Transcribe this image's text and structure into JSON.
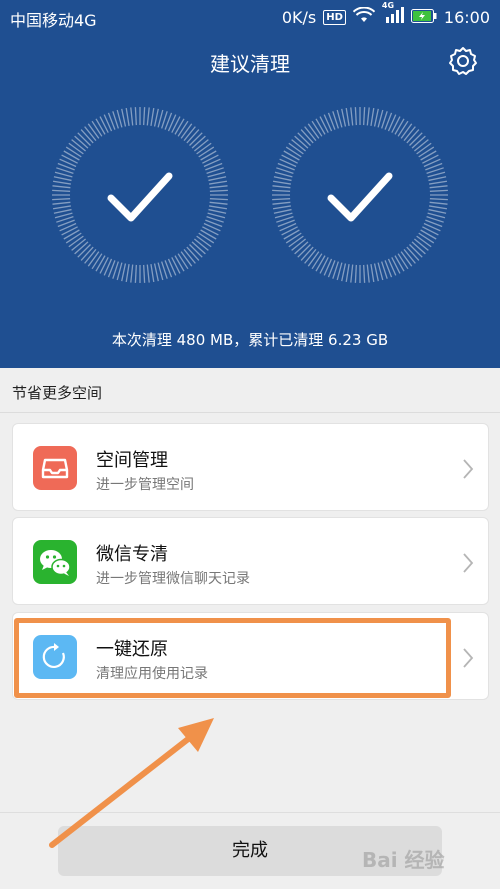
{
  "status_bar": {
    "carrier": "中国移动4G",
    "speed": "0K/s",
    "hd_badge": "HD",
    "network_badge": "4G",
    "time": "16:00"
  },
  "header": {
    "title": "建议清理",
    "summary": "本次清理 480 MB，累计已清理 6.23 GB"
  },
  "section": {
    "title": "节省更多空间"
  },
  "items": [
    {
      "title": "空间管理",
      "subtitle": "进一步管理空间",
      "icon": "storage-tray-icon",
      "color": "#ef6a57"
    },
    {
      "title": "微信专清",
      "subtitle": "进一步管理微信聊天记录",
      "icon": "wechat-icon",
      "color": "#2ab32f"
    },
    {
      "title": "一键还原",
      "subtitle": "清理应用使用记录",
      "icon": "restore-icon",
      "color": "#5cb8f3"
    }
  ],
  "footer": {
    "done_label": "完成"
  },
  "watermark": "Bai 经验",
  "colors": {
    "header_bg": "#1f4f91",
    "highlight": "#f0914a",
    "arrow": "#f0914a"
  }
}
